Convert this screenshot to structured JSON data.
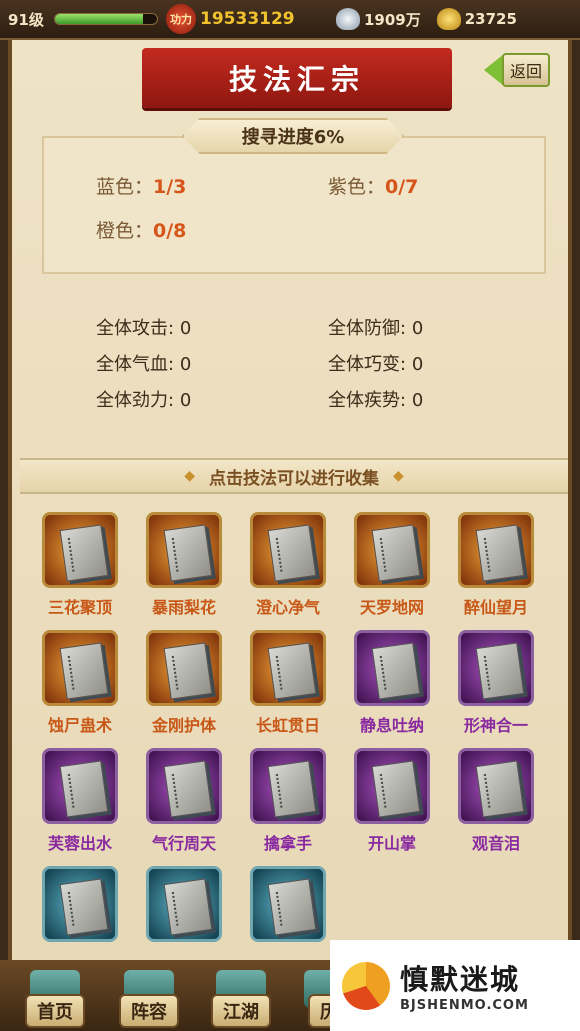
{
  "topbar": {
    "level": "91级",
    "exp_fraction": 0.86,
    "power_label": "功力",
    "power_value": "19533129",
    "silver_value": "1909万",
    "gold_value": "23725"
  },
  "page": {
    "title": "技法汇宗",
    "back_label": "返回",
    "progress_title": "搜寻进度6%"
  },
  "collection": {
    "blue_label": "蓝色：",
    "blue_value": "1/3",
    "purple_label": "紫色：",
    "purple_value": "0/7",
    "orange_label": "橙色：",
    "orange_value": "0/8"
  },
  "attributes": [
    {
      "label": "全体攻击:",
      "value": "0"
    },
    {
      "label": "全体防御:",
      "value": "0"
    },
    {
      "label": "全体气血:",
      "value": "0"
    },
    {
      "label": "全体巧变:",
      "value": "0"
    },
    {
      "label": "全体劲力:",
      "value": "0"
    },
    {
      "label": "全体疾势:",
      "value": "0"
    }
  ],
  "hint": "点击技法可以进行收集",
  "skills": [
    {
      "name": "三花聚顶",
      "rarity": "orange"
    },
    {
      "name": "暴雨梨花",
      "rarity": "orange"
    },
    {
      "name": "澄心净气",
      "rarity": "orange"
    },
    {
      "name": "天罗地网",
      "rarity": "orange"
    },
    {
      "name": "醉仙望月",
      "rarity": "orange"
    },
    {
      "name": "蚀尸蛊术",
      "rarity": "orange"
    },
    {
      "name": "金刚护体",
      "rarity": "orange"
    },
    {
      "name": "长虹贯日",
      "rarity": "orange"
    },
    {
      "name": "静息吐纳",
      "rarity": "purple"
    },
    {
      "name": "形神合一",
      "rarity": "purple"
    },
    {
      "name": "芙蓉出水",
      "rarity": "purple"
    },
    {
      "name": "气行周天",
      "rarity": "purple"
    },
    {
      "name": "擒拿手",
      "rarity": "purple"
    },
    {
      "name": "开山掌",
      "rarity": "purple"
    },
    {
      "name": "观音泪",
      "rarity": "purple"
    },
    {
      "name": "",
      "rarity": "blue"
    },
    {
      "name": "",
      "rarity": "blue"
    },
    {
      "name": "",
      "rarity": "blue"
    }
  ],
  "bottomnav": [
    {
      "label": "首页"
    },
    {
      "label": "阵容"
    },
    {
      "label": "江湖"
    },
    {
      "label": "历"
    }
  ],
  "watermark": {
    "title": "慎默迷城",
    "subtitle": "BJSHENMO.COM"
  }
}
